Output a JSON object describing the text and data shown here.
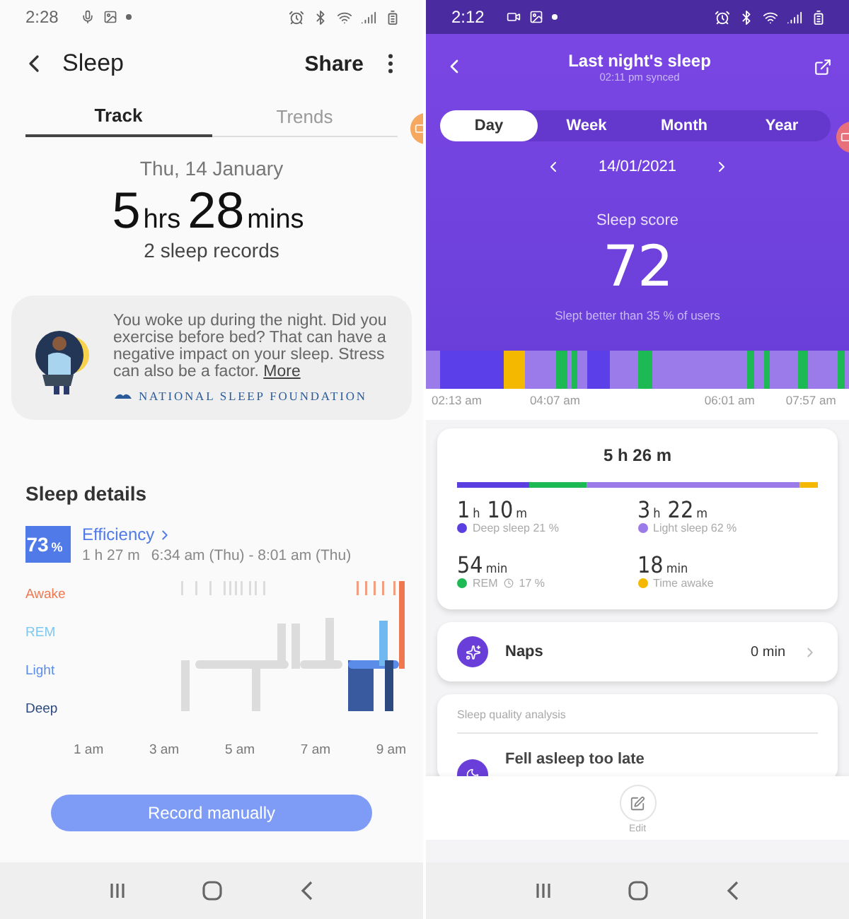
{
  "left_phone": {
    "status_bar": {
      "time": "2:28"
    },
    "header": {
      "title": "Sleep",
      "share": "Share"
    },
    "tabs": [
      {
        "label": "Track",
        "selected": true
      },
      {
        "label": "Trends",
        "selected": false
      }
    ],
    "date": "Thu, 14 January",
    "duration": [
      {
        "text": "5",
        "kind": "num"
      },
      {
        "text": "hrs",
        "kind": "unit"
      },
      {
        "text": "28",
        "kind": "num"
      },
      {
        "text": "mins",
        "kind": "unit"
      }
    ],
    "records": "2 sleep records",
    "tip": {
      "text": "You woke up during the night. Did you exercise before bed? That can have a negative impact on your sleep. Stress can also be a factor.",
      "link": "More",
      "source": "NATIONAL SLEEP FOUNDATION"
    },
    "details": {
      "title": "Sleep details",
      "badge": [
        {
          "text": "73",
          "kind": "num"
        },
        {
          "text": "%",
          "kind": "unit"
        }
      ],
      "label": "Efficiency",
      "length": "1 h 27 m",
      "range": "6:34 am (Thu) - 8:01 am (Thu)"
    },
    "hypnogram": {
      "stages": [
        {
          "label": "Awake",
          "color": "#f07850"
        },
        {
          "label": "REM",
          "color": "#7cc8f0"
        },
        {
          "label": "Light",
          "color": "#5b8de8"
        },
        {
          "label": "Deep",
          "color": "#2c4a80"
        }
      ],
      "times": [
        "1 am",
        "3 am",
        "5 am",
        "7 am",
        "9 am"
      ]
    },
    "record_button": "Record manually"
  },
  "right_phone": {
    "status_bar": {
      "time": "2:12"
    },
    "header": {
      "title": "Last night's sleep",
      "subtitle": "02:11 pm synced"
    },
    "periods": [
      {
        "label": "Day",
        "selected": true
      },
      {
        "label": "Week",
        "selected": false
      },
      {
        "label": "Month",
        "selected": false
      },
      {
        "label": "Year",
        "selected": false
      }
    ],
    "date": "14/01/2021",
    "score": {
      "label": "Sleep score",
      "value": "72",
      "comparison": "Slept better than 35 % of users"
    },
    "strip_times": [
      "02:13 am",
      "04:07 am",
      "06:01 am",
      "07:57 am"
    ],
    "summary": {
      "total": "5 h 26 m",
      "stages": [
        {
          "duration": [
            {
              "text": "1",
              "kind": "num"
            },
            {
              "text": "h",
              "kind": "unit"
            },
            {
              "text": "10",
              "kind": "num"
            },
            {
              "text": "m",
              "kind": "unit"
            }
          ],
          "label": "Deep sleep 21 %",
          "color": "#5b3fe0"
        },
        {
          "duration": [
            {
              "text": "3",
              "kind": "num"
            },
            {
              "text": "h",
              "kind": "unit"
            },
            {
              "text": "22",
              "kind": "num"
            },
            {
              "text": "m",
              "kind": "unit"
            }
          ],
          "label": "Light sleep 62 %",
          "color": "#9b7be9"
        },
        {
          "duration": [
            {
              "text": "54",
              "kind": "num"
            },
            {
              "text": "min",
              "kind": "unit"
            }
          ],
          "label": "REM",
          "suffix": "17 %",
          "color": "#1db954"
        },
        {
          "duration": [
            {
              "text": "18",
              "kind": "num"
            },
            {
              "text": "min",
              "kind": "unit"
            }
          ],
          "label": "Time awake",
          "color": "#f5b800"
        }
      ]
    },
    "naps": {
      "label": "Naps",
      "value": "0 min"
    },
    "analysis": {
      "title": "Sleep quality analysis",
      "item": "Fell asleep too late"
    },
    "edit": "Edit"
  }
}
